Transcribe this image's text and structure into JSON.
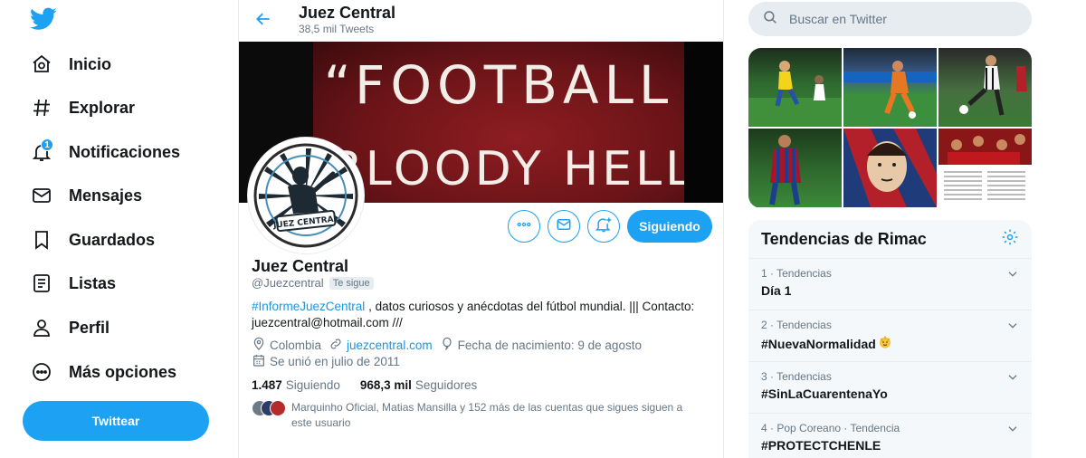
{
  "nav": {
    "items": [
      {
        "label": "Inicio",
        "icon": "home-icon"
      },
      {
        "label": "Explorar",
        "icon": "hashtag-icon"
      },
      {
        "label": "Notificaciones",
        "icon": "bell-icon",
        "badge": "1"
      },
      {
        "label": "Mensajes",
        "icon": "mail-icon"
      },
      {
        "label": "Guardados",
        "icon": "bookmark-icon"
      },
      {
        "label": "Listas",
        "icon": "list-icon"
      },
      {
        "label": "Perfil",
        "icon": "user-icon"
      },
      {
        "label": "Más opciones",
        "icon": "more-icon"
      }
    ],
    "tweet_button": "Twittear"
  },
  "header": {
    "name": "Juez Central",
    "tweet_count": "38,5 mil Tweets"
  },
  "banner": {
    "line1": "“FOOTBALL",
    "line2": "...BLOODY HELL ”"
  },
  "avatar": {
    "label": "JUEZ CENTRAL"
  },
  "profile": {
    "name": "Juez Central",
    "handle": "@Juezcentral",
    "follows_you": "Te sigue",
    "follow_button": "Siguiendo",
    "bio_hashtag": "#InformeJuezCentral",
    "bio_text": " , datos curiosos y anécdotas del fútbol mundial. ||| Contacto: juezcentral@hotmail.com ///",
    "location": "Colombia",
    "website": "juezcentral.com",
    "birthday": "Fecha de nacimiento: 9 de agosto",
    "joined": "Se unió en julio de 2011",
    "following_count": "1.487",
    "following_label": "Siguiendo",
    "followers_count": "968,3 mil",
    "followers_label": "Seguidores",
    "known_followers": "Marquinho Oficial, Matias Mansilla y 152 más de las cuentas que sigues siguen a este usuario"
  },
  "search": {
    "placeholder": "Buscar en Twitter"
  },
  "trends": {
    "title": "Tendencias de Rimac",
    "items": [
      {
        "meta": "1 · Tendencias",
        "name": "Día 1"
      },
      {
        "meta": "2 · Tendencias",
        "name": "#NuevaNormalidad"
      },
      {
        "meta": "3 · Tendencias",
        "name": "#SinLaCuarentenaYo"
      },
      {
        "meta": "4 · Pop Coreano · Tendencia",
        "name": "#PROTECTCHENLE"
      }
    ]
  },
  "colors": {
    "accent": "#1da1f2",
    "text": "#14171a",
    "muted": "#657786",
    "banner_red": "#8e1d22"
  }
}
